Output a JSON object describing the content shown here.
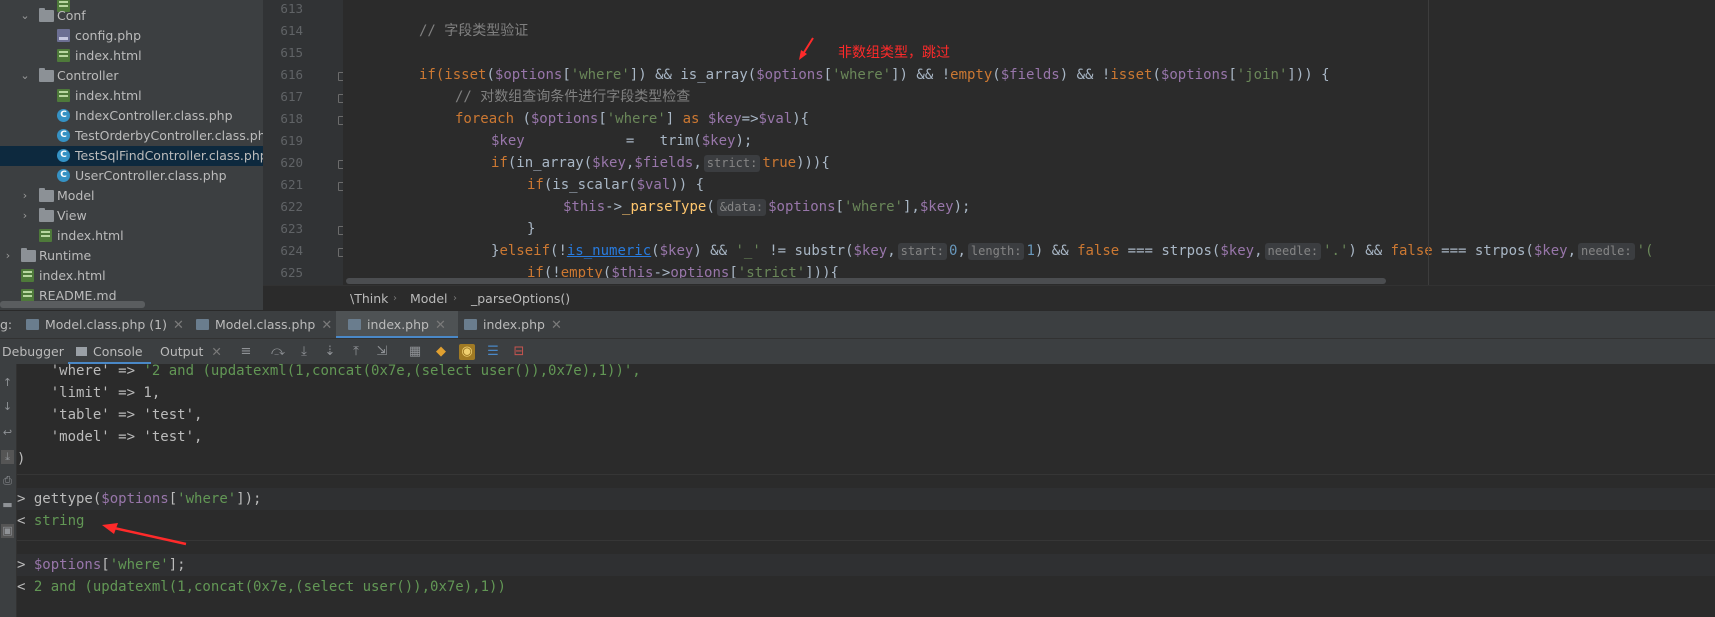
{
  "tree": {
    "items": [
      {
        "label": "Conf",
        "icon": "folder-icon"
      },
      {
        "label": "config.php",
        "icon": "php-file-icon"
      },
      {
        "label": "index.html",
        "icon": "html-file-icon"
      },
      {
        "label": "Controller",
        "icon": "folder-icon"
      },
      {
        "label": "index.html",
        "icon": "html-file-icon"
      },
      {
        "label": "IndexController.class.php",
        "icon": "class-icon"
      },
      {
        "label": "TestOrderbyController.class.php",
        "icon": "class-icon"
      },
      {
        "label": "TestSqlFindController.class.php",
        "icon": "class-icon"
      },
      {
        "label": "UserController.class.php",
        "icon": "class-icon"
      },
      {
        "label": "Model",
        "icon": "folder-icon"
      },
      {
        "label": "View",
        "icon": "folder-icon"
      },
      {
        "label": "index.html",
        "icon": "html-file-icon"
      },
      {
        "label": "Runtime",
        "icon": "folder-icon"
      },
      {
        "label": "index.html",
        "icon": "html-file-icon"
      },
      {
        "label": "README.md",
        "icon": "md-file-icon"
      }
    ]
  },
  "editor": {
    "line_numbers": [
      "613",
      "614",
      "615",
      "616",
      "617",
      "618",
      "619",
      "620",
      "621",
      "622",
      "623",
      "624",
      "625"
    ],
    "annotation": "非数组类型，跳过",
    "code": {
      "l614_comment": "// 字段类型验证",
      "l616": {
        "a": "if(",
        "b": "isset",
        "c": "(",
        "d": "$options",
        "e": "[",
        "f": "'where'",
        "g": "]) && ",
        "h": "is_array",
        "i": "(",
        "j": "$options",
        "k": "[",
        "l": "'where'",
        "m": "]) && !",
        "n": "empty",
        "o": "(",
        "p": "$fields",
        "q": ") && !",
        "r": "isset",
        "s": "(",
        "t": "$options",
        "u": "[",
        "v": "'join'",
        "w": "])) {"
      },
      "l617_comment": "// 对数组查询条件进行字段类型检查",
      "l618": {
        "a": "foreach ",
        "b": "(",
        "c": "$options",
        "d": "[",
        "e": "'where'",
        "f": "] ",
        "g": "as ",
        "h": "$key",
        "i": "=>",
        "j": "$val",
        "k": "){"
      },
      "l619": {
        "a": "$key",
        "b": "            =   ",
        "c": "trim",
        "d": "(",
        "e": "$key",
        "f": ");"
      },
      "l620": {
        "a": "if",
        "b": "(in_array(",
        "c": "$key",
        "d": ",",
        "e": "$fields",
        "f": ",",
        "hint": "strict:",
        "g": "true",
        "h": "))){"
      },
      "l621": {
        "a": "if",
        "b": "(is_scalar(",
        "c": "$val",
        "d": ")) {"
      },
      "l622": {
        "a": "$this",
        "b": "->",
        "c": "_parseType",
        "d": "(",
        "hint": "&data:",
        "e": "$options",
        "f": "[",
        "g": "'where'",
        "h": "],",
        "i": "$key",
        "j": ");"
      },
      "l623": "}",
      "l624": {
        "a": "}",
        "b": "elseif",
        "c": "(!",
        "d": "is_numeric",
        "e": "(",
        "f": "$key",
        "g": ") && ",
        "h": "'_'",
        "i": " != substr(",
        "j": "$key",
        "k": ",",
        "hint1": "start:",
        "l": "0",
        "m": ",",
        "hint2": "length:",
        "n": "1",
        "o": ") && ",
        "p": "false",
        "q": " === strpos(",
        "r": "$key",
        "s": ",",
        "hint3": "needle:",
        "t": "'.'",
        "u": ") && ",
        "v": "false",
        "w": " === strpos(",
        "x": "$key",
        "y": ",",
        "hint4": "needle:",
        "z": "'("
      },
      "l625": {
        "a": "if",
        "b": "(!",
        "c": "empty",
        "d": "(",
        "e": "$this",
        "f": "->",
        "g": "options",
        "h": "[",
        "i": "'strict'",
        "j": "])){"
      }
    }
  },
  "breadcrumb": [
    "\\Think",
    "Model",
    "_parseOptions()"
  ],
  "session_tabs": {
    "prefix": "g:",
    "tabs": [
      "Model.class.php (1)",
      "Model.class.php",
      "index.php",
      "index.php"
    ],
    "active": 2
  },
  "debug_tabs": [
    "Debugger",
    "Console",
    "Output"
  ],
  "console": {
    "lines": {
      "c1a": "    'where' => ",
      "c1b": "'2 and (updatexml(1,concat(0x7e,(select user()),0x7e),1))',",
      "c2": "    'limit' => 1,",
      "c3": "    'table' => 'test',",
      "c4": "    'model' => 'test',",
      "c5": ")",
      "cmd1_prompt": "> ",
      "cmd1_a": "gettype(",
      "cmd1_b": "$options",
      "cmd1_c": "[",
      "cmd1_d": "'where'",
      "cmd1_e": "]);",
      "res1_prompt": "< ",
      "res1": "string",
      "cmd2_prompt": "> ",
      "cmd2_a": "$options",
      "cmd2_b": "[",
      "cmd2_c": "'where'",
      "cmd2_d": "];",
      "res2_prompt": "< ",
      "res2": "2 and (updatexml(1,concat(0x7e,(select user()),0x7e),1))"
    }
  },
  "colors": {
    "annotation": "#ff2a2a",
    "accent": "#4a88c7"
  }
}
